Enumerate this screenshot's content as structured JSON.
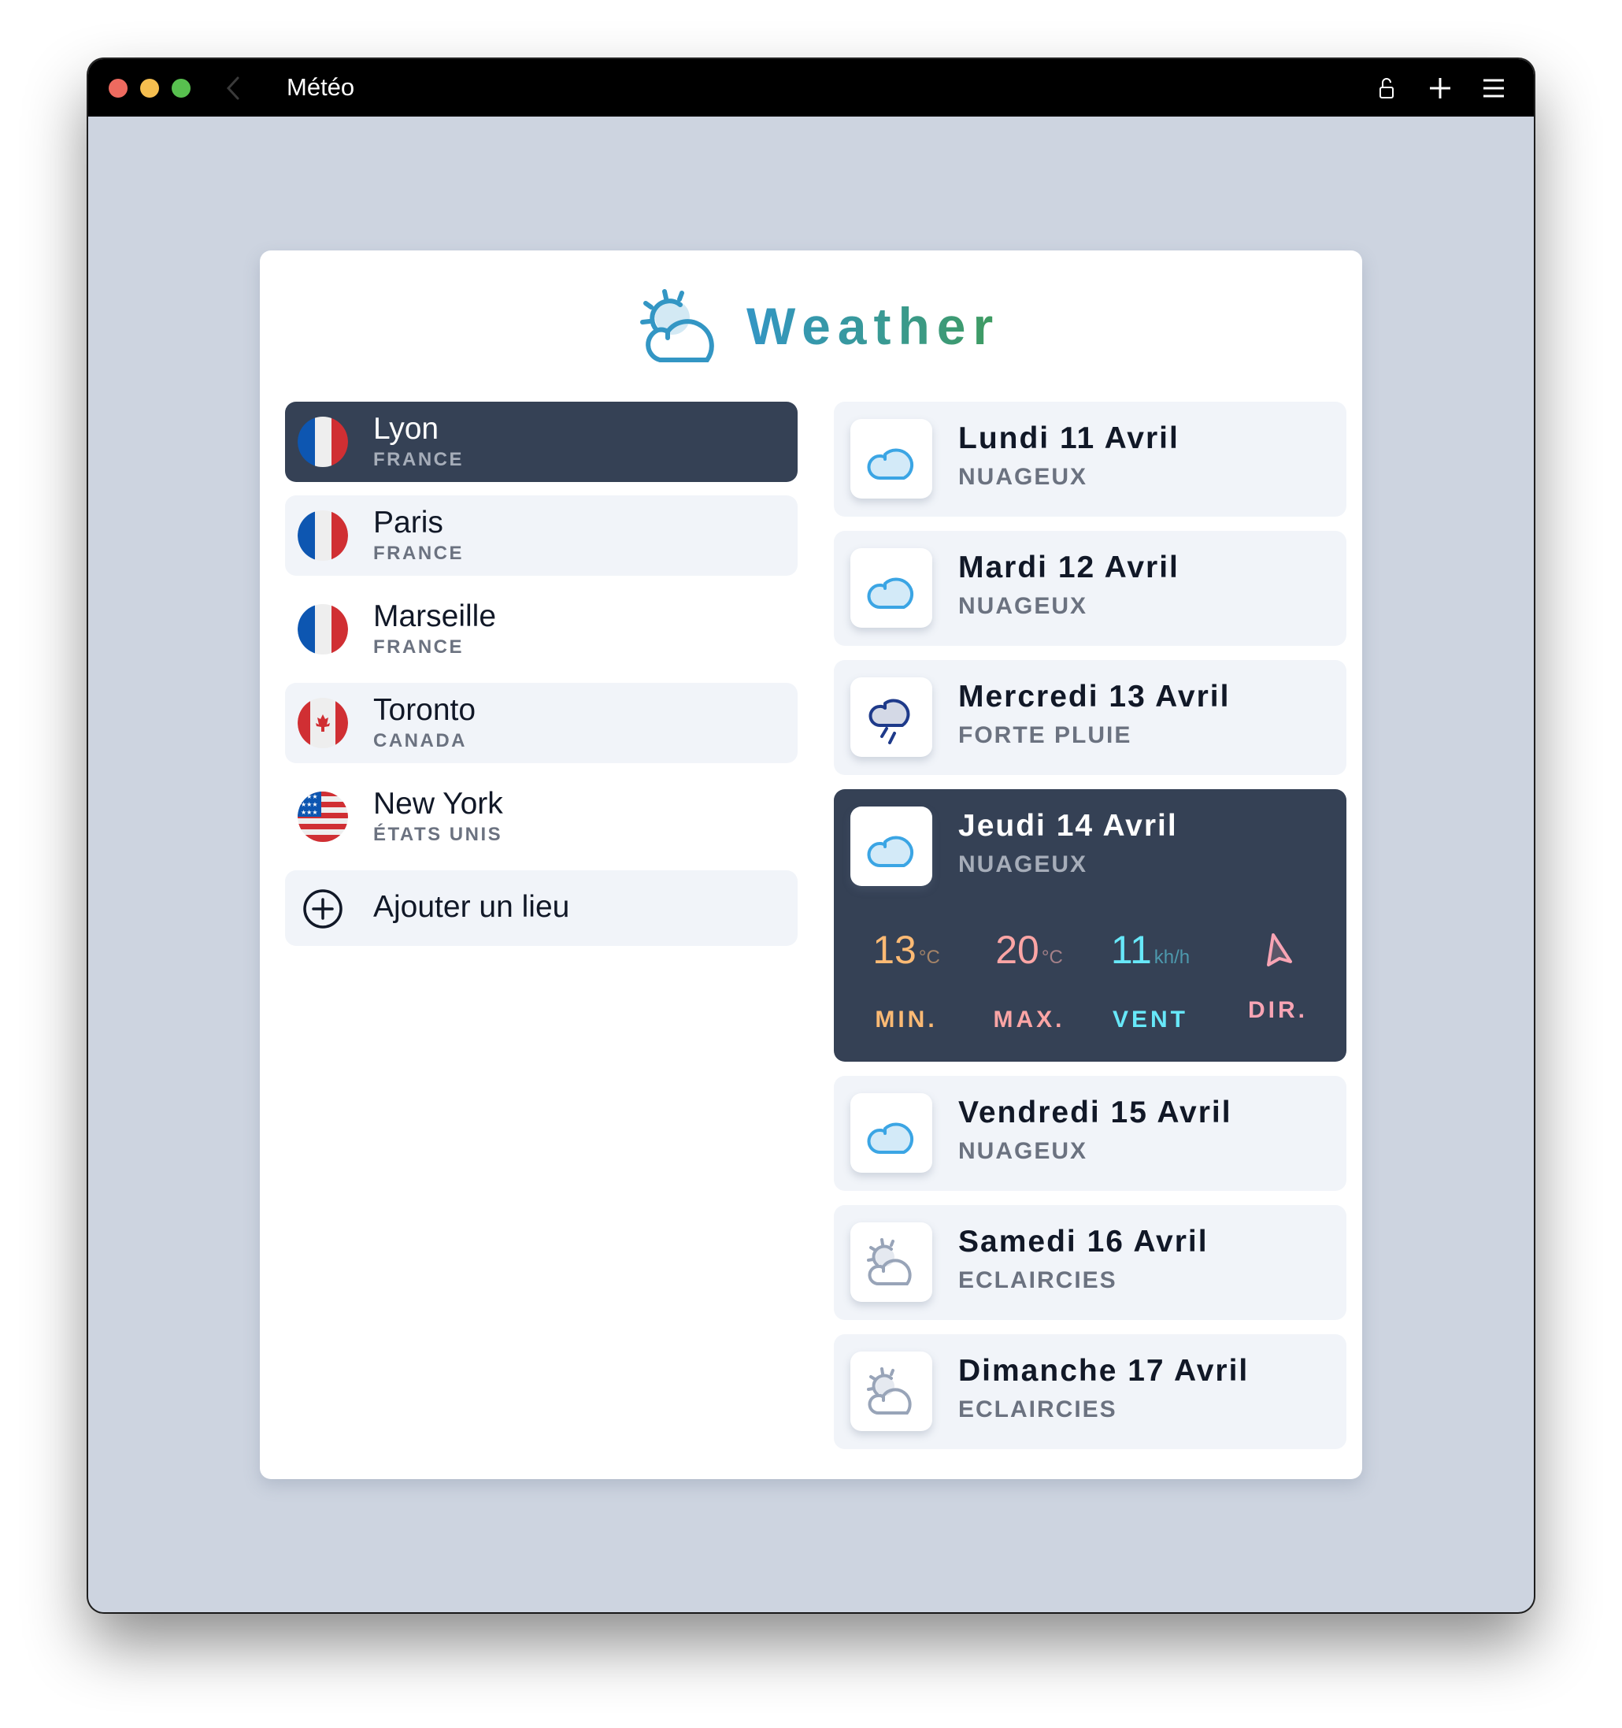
{
  "window": {
    "title": "Météo",
    "controls": [
      "close",
      "minimize",
      "maximize"
    ],
    "toolbar_icons": [
      "back-chevron-icon",
      "lock-open-icon",
      "plus-icon",
      "menu-icon"
    ]
  },
  "app": {
    "title": "Weather",
    "logo_icon": "sun-behind-cloud-icon",
    "title_gradient": [
      "#3396c4",
      "#3f9b5e"
    ]
  },
  "locations": [
    {
      "city": "Lyon",
      "country": "FRANCE",
      "flag": "fr",
      "selected": true
    },
    {
      "city": "Paris",
      "country": "FRANCE",
      "flag": "fr",
      "selected": false
    },
    {
      "city": "Marseille",
      "country": "FRANCE",
      "flag": "fr",
      "selected": false
    },
    {
      "city": "Toronto",
      "country": "CANADA",
      "flag": "ca",
      "selected": false
    },
    {
      "city": "New York",
      "country": "ÉTATS UNIS",
      "flag": "us",
      "selected": false
    }
  ],
  "add_location": {
    "label": "Ajouter un lieu",
    "icon": "plus-circle-icon"
  },
  "forecast": [
    {
      "day": "Lundi 11 Avril",
      "condition": "NUAGEUX",
      "icon": "cloud-icon"
    },
    {
      "day": "Mardi 12 Avril",
      "condition": "NUAGEUX",
      "icon": "cloud-icon"
    },
    {
      "day": "Mercredi 13 Avril",
      "condition": "FORTE PLUIE",
      "icon": "heavy-rain-icon"
    },
    {
      "day": "Jeudi 14 Avril",
      "condition": "NUAGEUX",
      "icon": "cloud-icon",
      "selected": true,
      "details": {
        "min": {
          "value": "13",
          "unit": "°C",
          "label": "MIN."
        },
        "max": {
          "value": "20",
          "unit": "°C",
          "label": "MAX."
        },
        "wind": {
          "value": "11",
          "unit": "kh/h",
          "label": "VENT"
        },
        "direction": {
          "icon": "navigation-arrow-icon",
          "label": "DIR."
        }
      }
    },
    {
      "day": "Vendredi 15 Avril",
      "condition": "NUAGEUX",
      "icon": "cloud-icon"
    },
    {
      "day": "Samedi 16 Avril",
      "condition": "ECLAIRCIES",
      "icon": "partly-cloudy-icon"
    },
    {
      "day": "Dimanche 17 Avril",
      "condition": "ECLAIRCIES",
      "icon": "partly-cloudy-icon"
    }
  ],
  "colors": {
    "selected_bg": "#354155",
    "item_bg": "#f1f4f9",
    "min": "#fdba74",
    "max": "#fca5a5",
    "wind": "#67e8f9",
    "dir": "#f8a4b4"
  }
}
